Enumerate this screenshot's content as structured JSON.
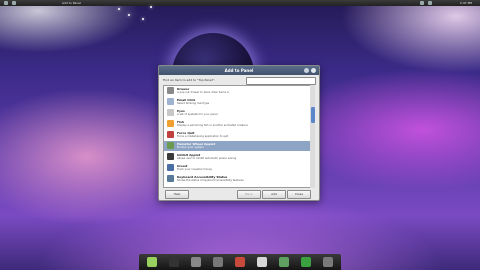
{
  "top_bar": {
    "title": "Add to Panel",
    "time": "2:47 PM"
  },
  "dialog": {
    "title": "Add to Panel",
    "find_label": "Find an item to add to \"Top Panel\":",
    "search_value": "",
    "items": [
      {
        "name": "Drawer",
        "desc": "A pop out drawer to store other items in",
        "icon": "drawer-icon",
        "color": "#8a8a8a"
      },
      {
        "name": "Email Click",
        "desc": "Select blinking mail type",
        "icon": "mail-icon",
        "color": "#9fb3d1"
      },
      {
        "name": "Eyes",
        "desc": "A set of eyeballs for your panel",
        "icon": "eyes-icon",
        "color": "#c7c7c7"
      },
      {
        "name": "Fish",
        "desc": "Display a swimming fish or another animated creature",
        "icon": "fish-icon",
        "color": "#f0a030"
      },
      {
        "name": "Force Quit",
        "desc": "Force a misbehaving application to quit",
        "icon": "force-quit-icon",
        "color": "#c04040"
      },
      {
        "name": "Hamster Wheel Applet",
        "desc": "Monitor your system",
        "icon": "hamster-icon",
        "color": "#6a9a50"
      },
      {
        "name": "Inhibit Applet",
        "desc": "Allows user to inhibit automatic power saving",
        "icon": "inhibit-icon",
        "color": "#3a3a3a"
      },
      {
        "name": "Invest",
        "desc": "Track your invested money",
        "icon": "invest-icon",
        "color": "#4a6fa5"
      },
      {
        "name": "Keyboard Accessibility Status",
        "desc": "Shows the status of keyboard accessibility features",
        "icon": "keyboard-icon",
        "color": "#5a7a9a"
      }
    ],
    "buttons": {
      "help": "Help",
      "back": "Back",
      "add": "Add",
      "close": "Close"
    }
  },
  "colors": {
    "selection": "#8ea4c4",
    "scroll_thumb": "#5b86c9",
    "titlebar": "#4a5c78"
  },
  "dock_items": [
    {
      "icon": "files-icon",
      "color": "#9ad060"
    },
    {
      "icon": "terminal-icon",
      "color": "#333333"
    },
    {
      "icon": "drive-icon",
      "color": "#888888"
    },
    {
      "icon": "folder-icon",
      "color": "#777777"
    },
    {
      "icon": "photos-icon",
      "color": "#c84a3a"
    },
    {
      "icon": "browser-icon",
      "color": "#d8d8d8"
    },
    {
      "icon": "music-icon",
      "color": "#60a060"
    },
    {
      "icon": "chat-icon",
      "color": "#3aa040"
    },
    {
      "icon": "trash-icon",
      "color": "#7a7a7a"
    }
  ]
}
